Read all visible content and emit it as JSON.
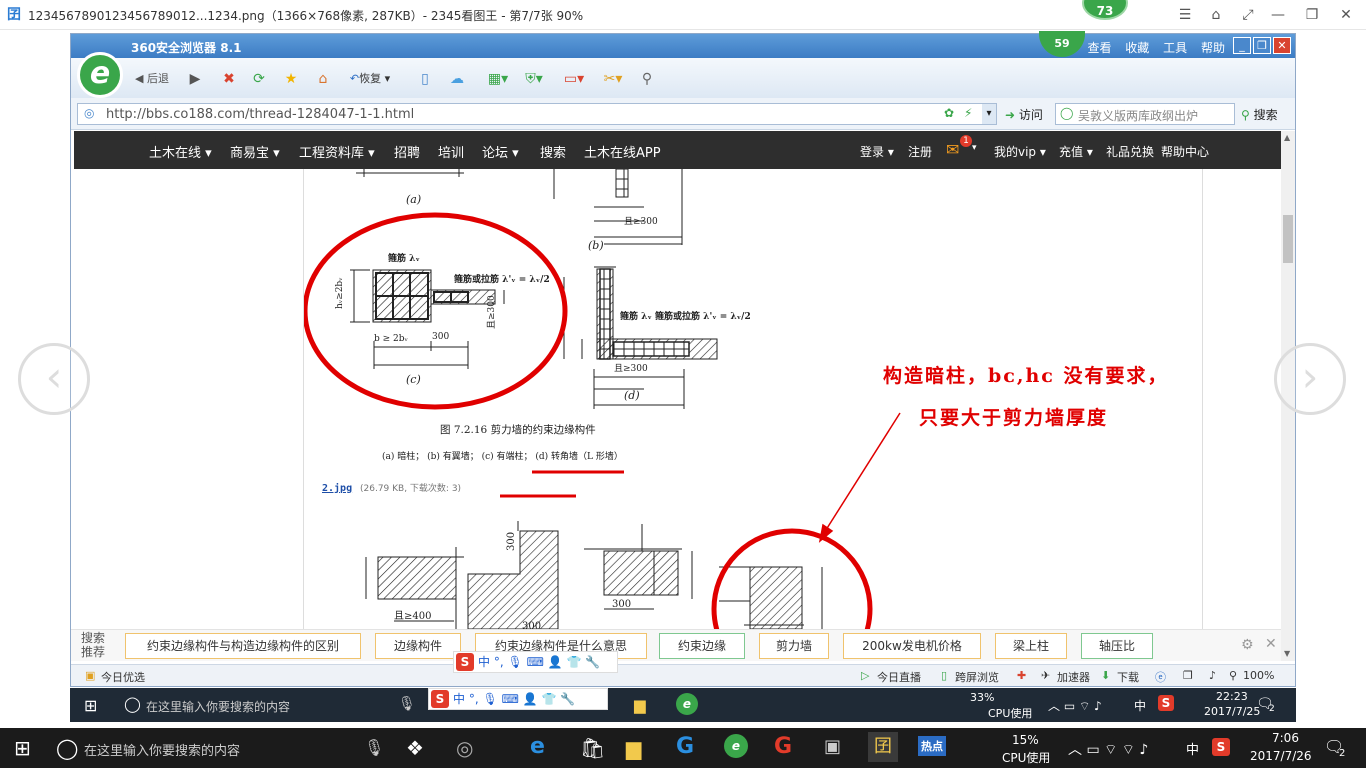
{
  "viewer": {
    "title": "1234567890123456789012...1234.png（1366×768像素, 287KB）- 2345看图王 - 第7/7张 90%",
    "badge": "73"
  },
  "browser": {
    "title": "360安全浏览器 8.1",
    "badge": "59",
    "menu": [
      "查看",
      "收藏",
      "工具",
      "帮助"
    ],
    "toolbar": {
      "back": "后退",
      "restore": "恢复"
    },
    "address": "http://bbs.co188.com/thread-1284047-1-1.html",
    "visit": "访问",
    "search_placeholder": "吴敦义版两库政纲出炉",
    "search_btn": "搜索"
  },
  "nav": {
    "left": [
      "土木在线 ▾",
      "商易宝 ▾",
      "工程资料库 ▾",
      "招聘",
      "培训",
      "论坛 ▾",
      "搜索",
      "土木在线APP"
    ],
    "right": [
      "登录 ▾",
      "注册",
      "我的vip ▾",
      "充值 ▾",
      "礼品兑换",
      "帮助中心"
    ],
    "mail_count": "1"
  },
  "figure": {
    "label_a": "(a)",
    "label_b": "(b)",
    "label_c": "(c)",
    "label_d": "(d)",
    "caption": "图 7.2.16   剪力墙的约束边缘构件",
    "subcaption": "(a) 暗柱； (b) 有翼墙； (c) 有端柱； (d) 转角墙（L 形墙）",
    "stirrup_c": "箍筋 λᵥ",
    "stirrup_c2": "箍筋或拉筋 λ'ᵥ = λᵥ/2",
    "stirrup_d": "箍筋 λᵥ  箍筋或拉筋 λ'ᵥ = λᵥ/2",
    "dim_300": "300",
    "dim_ge300": "且≥300",
    "dim_ge400": "且≥400",
    "dim_c1": "b ≥ 2bᵥ",
    "dim_c2": "hᵥ≥2bᵥ",
    "file_link": "2.jpg",
    "file_info": "(26.79 KB, 下载次数: 3)"
  },
  "annotation": {
    "line1": "构造暗柱，bᴄ,hᴄ 没有要求，",
    "line2": "只要大于剪力墙厚度",
    "color": "#e00000"
  },
  "recommend": {
    "label": "搜索推荐",
    "chips": [
      "约束边缘构件与构造边缘构件的区别",
      "边缘构件",
      "约束边缘构件是什么意思",
      "约束边缘",
      "剪力墙",
      "200kw发电机价格",
      "梁上柱",
      "轴压比"
    ]
  },
  "status": {
    "today": "今日优选",
    "live": "今日直播",
    "window": "跨屏浏览",
    "accel": "加速器",
    "download": "下载",
    "zoom": "100%"
  },
  "ime": {
    "zh": "中",
    "punct": "°,"
  },
  "taskbar_inner": {
    "search": "在这里输入你要搜索的内容",
    "cpu": "33%",
    "cpu_label": "CPU使用",
    "lang": "中",
    "time": "22:23",
    "date": "2017/7/25",
    "notif": "2"
  },
  "taskbar_outer": {
    "search": "在这里输入你要搜索的内容",
    "cpu": "15%",
    "cpu_label": "CPU使用",
    "lang": "中",
    "time": "7:06",
    "date": "2017/7/26",
    "notif": "2",
    "hot": "热点"
  }
}
